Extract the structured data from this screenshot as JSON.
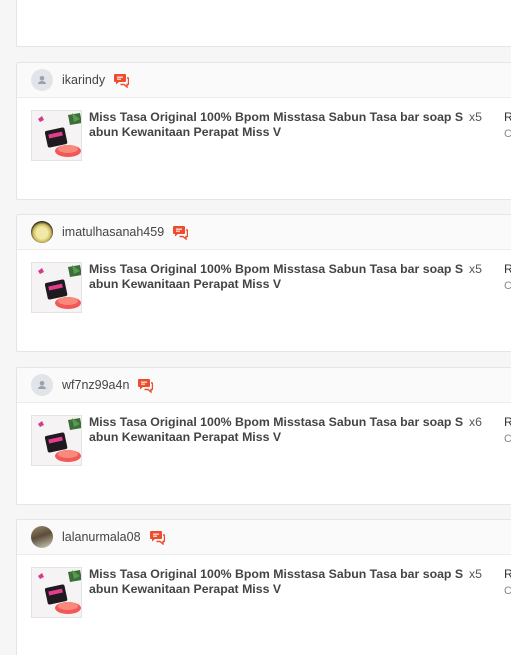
{
  "product_name": "Miss Tasa Original 100% Bpom Misstasa Sabun Tasa bar soap Sabun Kewanitaan Perapat Miss V",
  "price_initial": "R",
  "sub_initial": "C",
  "icons": {
    "default_avatar": "user-icon",
    "chat": "chat-icon"
  },
  "colors": {
    "chat_icon": "#ee4d2d",
    "card_bg": "#ffffff",
    "header_bg": "#fafafa"
  },
  "orders": [
    {
      "username": "ikarindy",
      "avatar": "default",
      "quantity": "x5"
    },
    {
      "username": "imatulhasanah459",
      "avatar": "photo",
      "quantity": "x5"
    },
    {
      "username": "wf7nz99a4n",
      "avatar": "default",
      "quantity": "x6"
    },
    {
      "username": "lalanurmala08",
      "avatar": "photo",
      "quantity": "x5"
    }
  ]
}
